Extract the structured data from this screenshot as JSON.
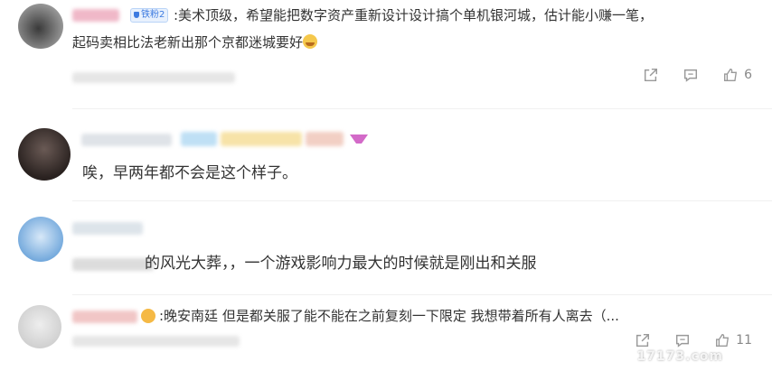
{
  "comments": [
    {
      "badge": "铁粉2",
      "text_line1": ":美术顶级，希望能把数字资产重新设计设计搞个单机银河城，估计能小赚一笔，",
      "text_line2": "起码卖相比法老新出那个京都迷城要好",
      "like_count": "6"
    },
    {
      "text": "唉，早两年都不会是这个样子。"
    },
    {
      "text": "的风光大葬，，一个游戏影响力最大的时候就是刚出和关服"
    },
    {
      "text": ":晚安南廷 但是都关服了能不能在之前复刻一下限定 我想带着所有人离去（...",
      "like_count": "11"
    }
  ],
  "watermark": "17173.com",
  "colors": {
    "badge_blue": "#3d7be0",
    "icon_gray": "#999999",
    "avatar_purple": "#d36ac8"
  }
}
